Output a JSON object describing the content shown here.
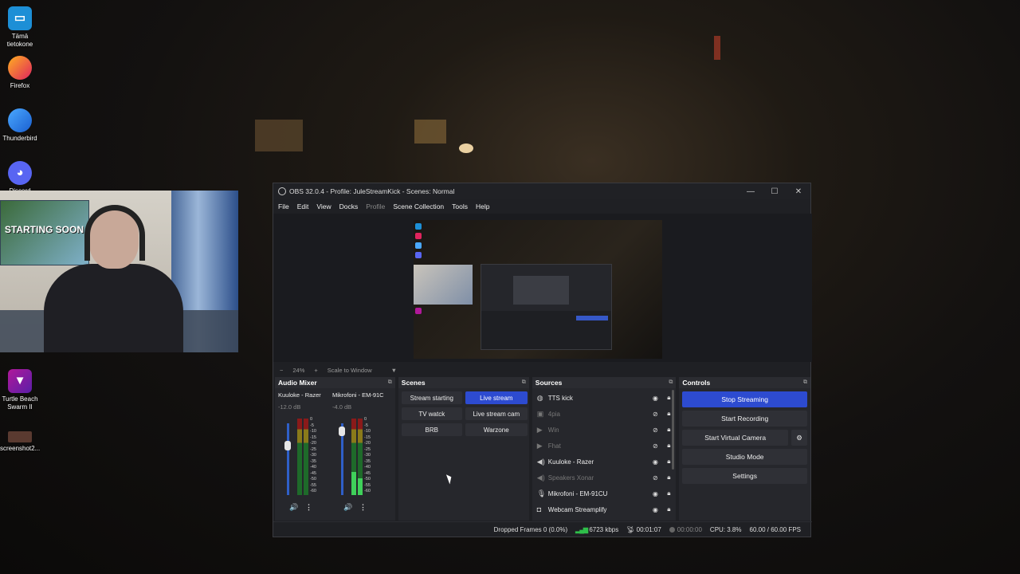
{
  "desktop": {
    "icons": [
      {
        "label": "Tämä tietokone",
        "icon": "monitor-icon"
      },
      {
        "label": "Firefox",
        "icon": "firefox-icon"
      },
      {
        "label": "Thunderbird",
        "icon": "thunderbird-icon"
      },
      {
        "label": "Discord",
        "icon": "discord-icon"
      },
      {
        "label": "Turtle Beach Swarm II",
        "icon": "turtle-beach-icon"
      },
      {
        "label": "screenshot2...",
        "icon": "image-file-icon"
      }
    ]
  },
  "webcam": {
    "poster_text": "STARTING SOON"
  },
  "obs": {
    "title": "OBS 32.0.4 - Profile: JuleStreamKick - Scenes: Normal",
    "window_controls": {
      "minimize": "—",
      "maximize": "☐",
      "close": "✕"
    },
    "menu": [
      "File",
      "Edit",
      "View",
      "Docks",
      "Profile",
      "Scene Collection",
      "Tools",
      "Help"
    ],
    "preview_controls": {
      "zoom_out": "−",
      "zoom": "24%",
      "zoom_in": "+",
      "scale_mode": "Scale to Window"
    },
    "audio_mixer": {
      "title": "Audio Mixer",
      "channels": [
        {
          "name": "Kuuloke - Razer",
          "db": "-12.0 dB",
          "level": 0.55
        },
        {
          "name": "Mikrofoni - EM-91C",
          "db": "-4.0 dB",
          "level": 0.75
        }
      ],
      "scale": [
        "0",
        "-5",
        "-10",
        "-15",
        "-20",
        "-25",
        "-30",
        "-35",
        "-40",
        "-45",
        "-50",
        "-55",
        "-60"
      ]
    },
    "scenes": {
      "title": "Scenes",
      "items": [
        {
          "label": "Stream starting",
          "active": false
        },
        {
          "label": "Live stream",
          "active": true
        },
        {
          "label": "TV watck",
          "active": false
        },
        {
          "label": "Live stream cam",
          "active": false
        },
        {
          "label": "BRB",
          "active": false
        },
        {
          "label": "Warzone",
          "active": false
        }
      ]
    },
    "sources": {
      "title": "Sources",
      "items": [
        {
          "name": "TTS kick",
          "icon": "globe-icon",
          "visible": true
        },
        {
          "name": "4pia",
          "icon": "image-icon",
          "visible": false
        },
        {
          "name": "Win",
          "icon": "play-icon",
          "visible": false
        },
        {
          "name": "Fhat",
          "icon": "play-icon",
          "visible": false
        },
        {
          "name": "Kuuloke - Razer",
          "icon": "speaker-icon",
          "visible": true
        },
        {
          "name": "Speakers Xonar",
          "icon": "speaker-icon",
          "visible": false
        },
        {
          "name": "Mikrofoni - EM-91CU",
          "icon": "microphone-icon",
          "visible": true
        },
        {
          "name": "Webcam Streamplify",
          "icon": "camera-icon",
          "visible": true
        }
      ]
    },
    "controls": {
      "title": "Controls",
      "stop_streaming": "Stop Streaming",
      "start_recording": "Start Recording",
      "start_virtual_camera": "Start Virtual Camera",
      "studio_mode": "Studio Mode",
      "settings": "Settings"
    },
    "status": {
      "dropped_frames": "Dropped Frames 0 (0.0%)",
      "bitrate": "6723 kbps",
      "stream_time": "00:01:07",
      "rec_time": "00:00:00",
      "cpu": "CPU: 3.8%",
      "fps": "60.00 / 60.00 FPS"
    },
    "accent_color": "#2d4bd0"
  }
}
